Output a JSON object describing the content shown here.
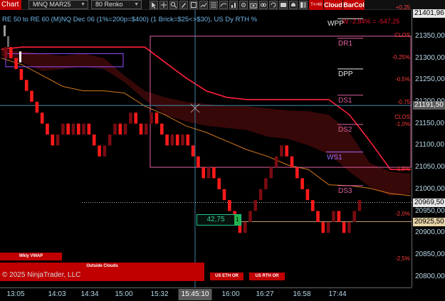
{
  "toolbar": {
    "chart_label": "Chart",
    "instrument": "MNQ MAR25",
    "bar_type": "80 Renko",
    "tm_label": "T<>M",
    "cloud_label": "Cloud",
    "barcol_label": "BarCol"
  },
  "chart": {
    "title": "RE 50 to RE 60 (M)NQ Dec 06 (1%=200p=$400) (1 Brick=$25<>$30), US Dy RTH %",
    "wp_overlay": "W -2,84% = -547,25",
    "wp_label": "WPP",
    "copyright": "© 2025 NinjaTrader, LLC",
    "counter_value": "42,75",
    "counter_side": "1"
  },
  "colors": {
    "up_brick": "#7a0c12",
    "down_brick": "#ff1a1a",
    "cloud": "#3a0808",
    "band": "#ff1f3a",
    "orange_line": "#d4781a",
    "box": "#e060a0",
    "crosshair": "#4aa0c8"
  },
  "price_axis": {
    "ticks": [
      "21350,00",
      "21300,00",
      "21250,00",
      "21200,00",
      "21150,00",
      "21100,00",
      "21050,00",
      "21000,00",
      "20950,00",
      "20900,00",
      "20850,00",
      "20800,00"
    ],
    "tick_values": [
      21350,
      21300,
      21250,
      21200,
      21150,
      21100,
      21050,
      21000,
      20950,
      20900,
      20850,
      20800
    ],
    "price_min": 20775,
    "price_max": 21410,
    "boxes": [
      {
        "label": "21401,96",
        "value": 21401.96,
        "bg": "#e8e8e8",
        "fg": "#000000"
      },
      {
        "label": "21191,50",
        "value": 21191.5,
        "bg": "#5c5c5c",
        "fg": "#ffffff"
      },
      {
        "label": "20969,50",
        "value": 20969.5,
        "bg": "#e8e8e8",
        "fg": "#000000"
      },
      {
        "label": "20925,50",
        "value": 20925.5,
        "bg": "#e8d4a8",
        "fg": "#000000"
      }
    ]
  },
  "levels": [
    {
      "label": "WPP",
      "value": 21390,
      "color": "#e8e8e8"
    },
    {
      "label": "DR1",
      "value": 21345,
      "color": "#e060a0"
    },
    {
      "label": "DPP",
      "value": 21275,
      "color": "#e8e8e8"
    },
    {
      "label": "DS1",
      "value": 21215,
      "color": "#e060a0"
    },
    {
      "label": "DS2",
      "value": 21148,
      "color": "#e060a0"
    },
    {
      "label": "WS1",
      "value": 21085,
      "color": "#9a6cff"
    },
    {
      "label": "DS3",
      "value": 21008,
      "color": "#e060a0"
    }
  ],
  "pct_labels": [
    {
      "text": "+0,25",
      "value": 21415
    },
    {
      "text": "CLOS",
      "value": 21352
    },
    {
      "text": "-0,25%",
      "value": 21301
    },
    {
      "text": "-0,5%",
      "value": 21250
    },
    {
      "text": "-0,75",
      "value": 21198
    },
    {
      "text": "CLOS",
      "value": 21164
    },
    {
      "text": "-1,0%",
      "value": 21148
    },
    {
      "text": "-1,5%",
      "value": 21046
    },
    {
      "text": "-2,0%",
      "value": 20943
    },
    {
      "text": "-2,5%",
      "value": 20840
    }
  ],
  "time_axis": {
    "labels": [
      "13:05",
      "14:03",
      "14:34",
      "15:00",
      "15:32",
      "16:00",
      "16:27",
      "16:58",
      "17:44"
    ],
    "crosshair_label": "15:45:10"
  },
  "footer": {
    "wkly_vwap": "Wkly VWAP",
    "outside_clouds": "Outside Clouds",
    "us_eth_or": "US ETH OR",
    "us_rth_or": "US RTH OR"
  },
  "chart_data": {
    "type": "renko",
    "instrument": "MNQ MAR25",
    "bars": "80 Renko",
    "brick_size": 25,
    "price_range": [
      20775,
      21410
    ],
    "bricks": [
      {
        "close": 21325,
        "dir": "up"
      },
      {
        "close": 21300,
        "dir": "down"
      },
      {
        "close": 21275,
        "dir": "down"
      },
      {
        "close": 21250,
        "dir": "down"
      },
      {
        "close": 21225,
        "dir": "down"
      },
      {
        "close": 21200,
        "dir": "down"
      },
      {
        "close": 21175,
        "dir": "down"
      },
      {
        "close": 21150,
        "dir": "down"
      },
      {
        "close": 21125,
        "dir": "down"
      },
      {
        "close": 21100,
        "dir": "down"
      },
      {
        "close": 21125,
        "dir": "up"
      },
      {
        "close": 21150,
        "dir": "up"
      },
      {
        "close": 21125,
        "dir": "down"
      },
      {
        "close": 21150,
        "dir": "up"
      },
      {
        "close": 21125,
        "dir": "down"
      },
      {
        "close": 21150,
        "dir": "up"
      },
      {
        "close": 21125,
        "dir": "down"
      },
      {
        "close": 21100,
        "dir": "down"
      },
      {
        "close": 21075,
        "dir": "down"
      },
      {
        "close": 21100,
        "dir": "up"
      },
      {
        "close": 21125,
        "dir": "up"
      },
      {
        "close": 21150,
        "dir": "up"
      },
      {
        "close": 21125,
        "dir": "down"
      },
      {
        "close": 21150,
        "dir": "up"
      },
      {
        "close": 21175,
        "dir": "up"
      },
      {
        "close": 21150,
        "dir": "down"
      },
      {
        "close": 21125,
        "dir": "down"
      },
      {
        "close": 21150,
        "dir": "up"
      },
      {
        "close": 21175,
        "dir": "up"
      },
      {
        "close": 21150,
        "dir": "down"
      },
      {
        "close": 21125,
        "dir": "down"
      },
      {
        "close": 21100,
        "dir": "down"
      },
      {
        "close": 21125,
        "dir": "up"
      },
      {
        "close": 21100,
        "dir": "down"
      },
      {
        "close": 21125,
        "dir": "up"
      },
      {
        "close": 21100,
        "dir": "down"
      },
      {
        "close": 21075,
        "dir": "down"
      },
      {
        "close": 21050,
        "dir": "down"
      },
      {
        "close": 21025,
        "dir": "down"
      },
      {
        "close": 21050,
        "dir": "up"
      },
      {
        "close": 21025,
        "dir": "down"
      },
      {
        "close": 21000,
        "dir": "down"
      },
      {
        "close": 20975,
        "dir": "down"
      },
      {
        "close": 20950,
        "dir": "down"
      },
      {
        "close": 20925,
        "dir": "down"
      },
      {
        "close": 20900,
        "dir": "down"
      },
      {
        "close": 20925,
        "dir": "up"
      },
      {
        "close": 20950,
        "dir": "up"
      },
      {
        "close": 20975,
        "dir": "up"
      },
      {
        "close": 21000,
        "dir": "up"
      },
      {
        "close": 21025,
        "dir": "up"
      },
      {
        "close": 21050,
        "dir": "up"
      },
      {
        "close": 21075,
        "dir": "up"
      },
      {
        "close": 21100,
        "dir": "up"
      },
      {
        "close": 21075,
        "dir": "down"
      },
      {
        "close": 21050,
        "dir": "down"
      },
      {
        "close": 21025,
        "dir": "down"
      },
      {
        "close": 21000,
        "dir": "down"
      },
      {
        "close": 20975,
        "dir": "down"
      },
      {
        "close": 20950,
        "dir": "down"
      },
      {
        "close": 20925,
        "dir": "down"
      },
      {
        "close": 20900,
        "dir": "down"
      },
      {
        "close": 20925,
        "dir": "up"
      },
      {
        "close": 20950,
        "dir": "up"
      },
      {
        "close": 20925,
        "dir": "down"
      },
      {
        "close": 20900,
        "dir": "down"
      },
      {
        "close": 20925,
        "dir": "up"
      },
      {
        "close": 20950,
        "dir": "up"
      },
      {
        "close": 20975,
        "dir": "up"
      }
    ],
    "orange_line": [
      21300,
      21285,
      21260,
      21235,
      21225,
      21225,
      21220,
      21190,
      21170,
      21145,
      21130,
      21110,
      21090,
      21075,
      21055,
      21045,
      21010,
      21008,
      21002,
      20990,
      20985
    ],
    "cloud_upper": [
      21320,
      21315,
      21310,
      21305,
      21310,
      21300,
      21260,
      21225,
      21210,
      21200,
      21195,
      21190,
      21190,
      21185,
      21180,
      21178,
      21170,
      21130,
      21060,
      21040,
      21035
    ],
    "cloud_lower": [
      21305,
      21290,
      21270,
      21275,
      21280,
      21275,
      21245,
      21205,
      21170,
      21155,
      21145,
      21140,
      21135,
      21120,
      21115,
      21100,
      21080,
      21040,
      21005,
      20985,
      20990
    ],
    "red_band": [
      21320,
      21325,
      21325,
      21325,
      21325,
      21325,
      21325,
      21325,
      21290,
      21255,
      21225,
      21210,
      21205,
      21205,
      21205,
      21205,
      21205,
      21170,
      21110,
      21045,
      21045
    ]
  }
}
